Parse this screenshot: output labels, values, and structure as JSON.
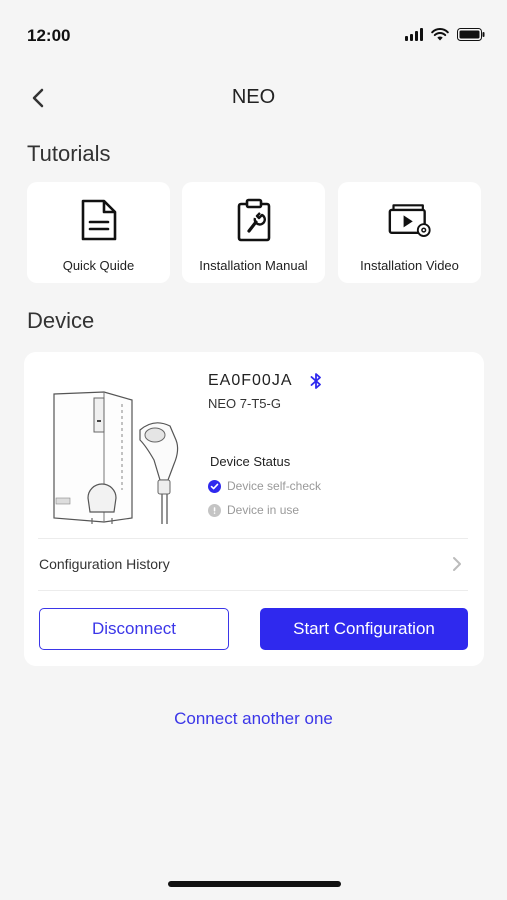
{
  "status_bar": {
    "time": "12:00"
  },
  "header": {
    "title": "NEO"
  },
  "tutorials": {
    "title": "Tutorials",
    "items": [
      {
        "label": "Quick Quide",
        "icon": "document-icon"
      },
      {
        "label": "Installation Manual",
        "icon": "wrench-clipboard-icon"
      },
      {
        "label": "Installation Video",
        "icon": "video-settings-icon"
      }
    ]
  },
  "device": {
    "section_title": "Device",
    "id": "EA0F00JA",
    "model": "NEO 7-T5-G",
    "status_title": "Device Status",
    "statuses": [
      {
        "label": "Device self-check",
        "state": "done"
      },
      {
        "label": "Device in use",
        "state": "info"
      }
    ],
    "config_history_label": "Configuration History",
    "disconnect_label": "Disconnect",
    "start_config_label": "Start Configuration"
  },
  "connect_another_label": "Connect another one",
  "colors": {
    "accent": "#2f29ee",
    "background": "#f5f5f5",
    "card": "#ffffff"
  }
}
